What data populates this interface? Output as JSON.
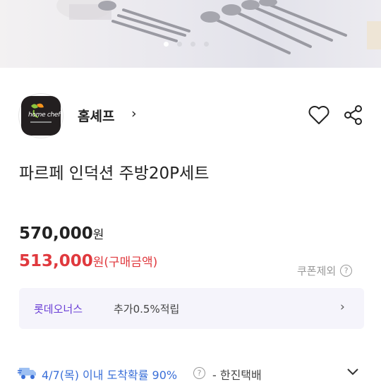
{
  "brand": {
    "name": "홈셰프",
    "chevron": "›",
    "logo_text": "home chef"
  },
  "product": {
    "title": "파르페 인덕션 주방20P세트"
  },
  "price": {
    "original": "570,000",
    "original_unit": "원",
    "sale": "513,000",
    "sale_unit": "원(구매금액)"
  },
  "coupon": {
    "label": "쿠폰제외",
    "help": "?"
  },
  "benefit": {
    "name": "롯데오너스",
    "desc": "추가0.5%적립",
    "chevron": "›"
  },
  "delivery": {
    "text": "4/7(목) 이내 도착확률 90%",
    "help": "?",
    "carrier": "- 한진택배"
  },
  "carousel": {
    "dot_count": 4,
    "active_index": 0
  },
  "colors": {
    "accent_red": "#e0393e",
    "benefit_purple": "#6b3fd6",
    "delivery_blue": "#3a6fd8"
  },
  "icons": [
    "heart-icon",
    "share-icon",
    "truck-icon",
    "chevron-down-icon",
    "help-icon"
  ]
}
